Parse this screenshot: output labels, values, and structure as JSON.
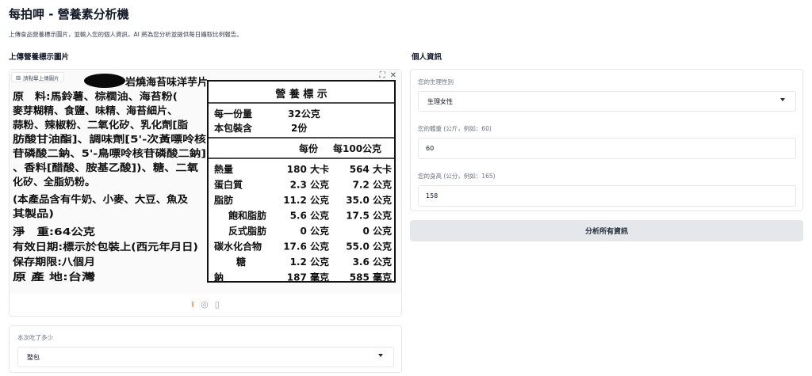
{
  "app": {
    "title": "每拍呷 - 營養素分析機",
    "description": "上傳食品營養標示圖片，並輸入您的個人資訊，AI 將為您分析並提供每日攝取比例報告。"
  },
  "upload": {
    "section_label": "上傳營養標示圖片",
    "image_chip_label": "請點擊上傳圖片",
    "tool_icons": [
      "expand-icon",
      "close-icon"
    ],
    "footer_icons": [
      "upload-icon",
      "camera-icon",
      "clipboard-icon"
    ]
  },
  "label_photo": {
    "product_name": "岩燒海苔味洋芋片",
    "ingredients": [
      "原　料:馬鈴薯、棕櫚油、海苔粉(",
      "麥芽糊精、食鹽、味精、海苔細片、",
      "蒜粉、辣椒粉、二氧化矽、乳化劑[脂",
      "肪酸甘油酯]、調味劑[5'-次黃嘌呤核",
      "苷磷酸二鈉、5'-鳥嘌呤核苷磷酸二鈉]",
      "、香料[醋酸、胺基乙酸])、糖、二氧",
      "化矽、全脂奶粉。",
      "(本產品含有牛奶、小麥、大豆、魚及",
      "其製品)",
      "淨　重:64公克",
      "有效日期:標示於包裝上(西元年月日)",
      "保存期限:八個月",
      "原 產 地:台灣"
    ],
    "nutrition_title": "營 養 標 示",
    "serving_size_label": "每一份量",
    "serving_size_value": "32公克",
    "servings_label": "本包裝含",
    "servings_value": "2份",
    "col_per_serving": "每份",
    "col_per_100g": "每100公克",
    "rows": [
      {
        "name": "熱量",
        "per_serving": "180 大卡",
        "per_100g": "564 大卡"
      },
      {
        "name": "蛋白質",
        "per_serving": "2.3 公克",
        "per_100g": "7.2 公克"
      },
      {
        "name": "脂肪",
        "per_serving": "11.2 公克",
        "per_100g": "35.0 公克"
      },
      {
        "name": "飽和脂肪",
        "per_serving": "5.6 公克",
        "per_100g": "17.5 公克"
      },
      {
        "name": "反式脂肪",
        "per_serving": "0 公克",
        "per_100g": "0 公克"
      },
      {
        "name": "碳水化合物",
        "per_serving": "17.6 公克",
        "per_100g": "55.0 公克"
      },
      {
        "name": "糖",
        "per_serving": "1.2 公克",
        "per_100g": "3.6 公克"
      },
      {
        "name": "鈉",
        "per_serving": "187 毫克",
        "per_100g": "585 毫克"
      }
    ]
  },
  "portion": {
    "label": "本次吃了多少",
    "selected": "整包"
  },
  "personal": {
    "section_label": "個人資訊",
    "sex_label": "您的生理性別",
    "sex_selected": "生理女性",
    "weight_label": "您的體重 (公斤，例如：60)",
    "weight_value": "60",
    "height_label": "您的身高 (公分，例如：165)",
    "height_value": "158"
  },
  "actions": {
    "analyze_label": "分析所有資訊"
  },
  "colors": {
    "accent": "#f97316",
    "button_bg": "#e5e7eb",
    "border": "#e5e7eb"
  }
}
